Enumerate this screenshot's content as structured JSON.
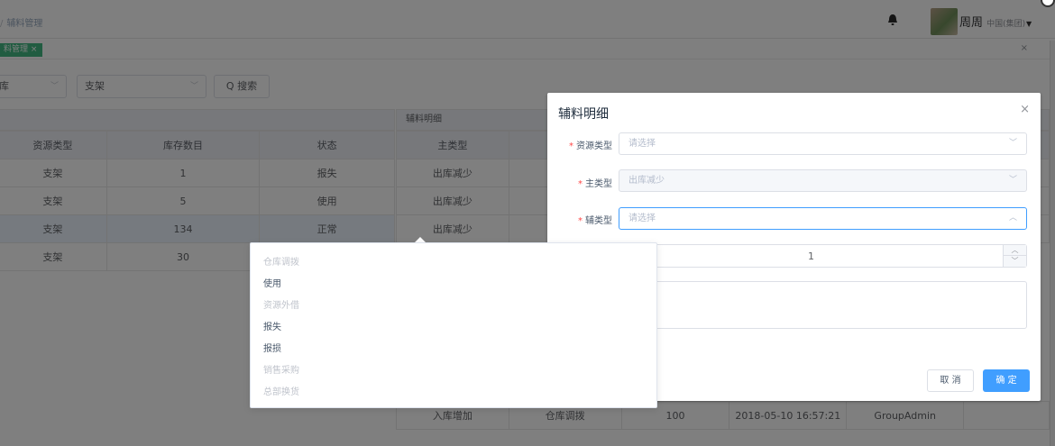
{
  "breadcrumb": {
    "sep": "/",
    "current": "辅料管理"
  },
  "user": {
    "name": "周周",
    "org": "中国(集团)"
  },
  "tags": {
    "active": "料管理",
    "close": "×"
  },
  "filters": {
    "first_value": "库",
    "second_value": "支架",
    "search_label": "Q 搜索"
  },
  "left_table": {
    "headers": [
      "资源类型",
      "库存数目",
      "状态"
    ],
    "rows": [
      [
        "支架",
        "1",
        "报失"
      ],
      [
        "支架",
        "5",
        "使用"
      ],
      [
        "支架",
        "134",
        "正常"
      ],
      [
        "支架",
        "30",
        ""
      ]
    ]
  },
  "detail_panel": {
    "title": "辅料明细",
    "header_main_type": "主类型",
    "rows": [
      "出库减少",
      "出库减少",
      "出库减少"
    ],
    "bottom_row": {
      "main_type": "入库增加",
      "sub_type": "仓库调拨",
      "qty": "100",
      "time": "2018-05-10 16:57:21",
      "user": "GroupAdmin"
    }
  },
  "dialog": {
    "title": "辅料明细",
    "close": "×",
    "fields": {
      "resource_type": {
        "label": "资源类型",
        "placeholder": "请选择"
      },
      "main_type": {
        "label": "主类型",
        "value": "出库减少"
      },
      "sub_type": {
        "label": "辅类型",
        "placeholder": "请选择"
      },
      "quantity": {
        "value": "1"
      }
    },
    "cancel_label": "取 消",
    "ok_label": "确 定"
  },
  "dropdown": {
    "options": [
      {
        "label": "仓库调拨",
        "disabled": true
      },
      {
        "label": "使用",
        "disabled": false
      },
      {
        "label": "资源外借",
        "disabled": true
      },
      {
        "label": "报失",
        "disabled": false
      },
      {
        "label": "报损",
        "disabled": false
      },
      {
        "label": "销售采购",
        "disabled": true
      },
      {
        "label": "总部换货",
        "disabled": true
      }
    ]
  },
  "colors": {
    "primary": "#409eff",
    "tag_green": "#42b983",
    "required": "#ff4949"
  }
}
